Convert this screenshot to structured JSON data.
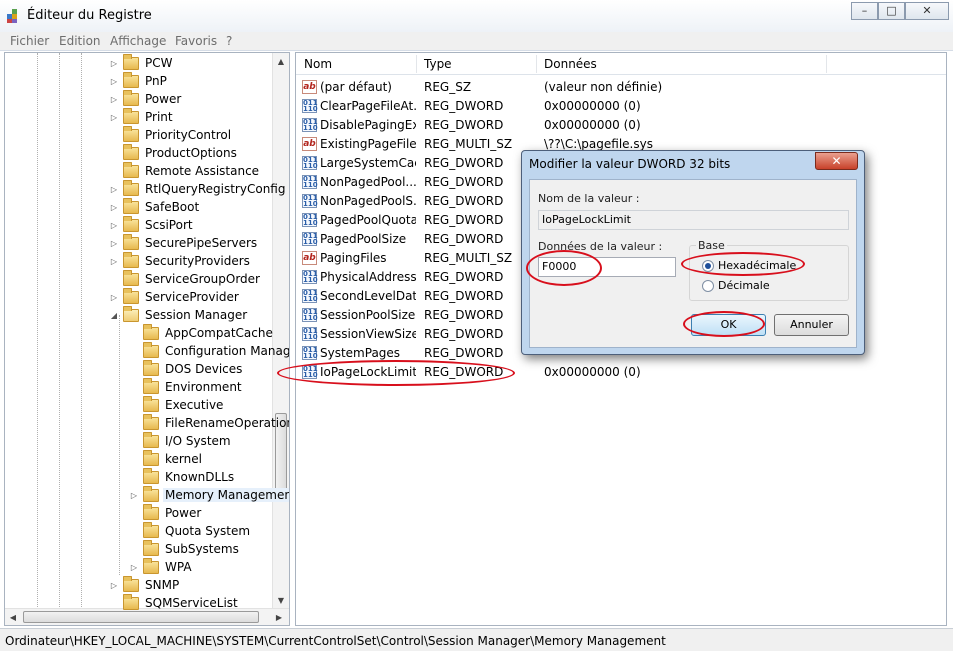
{
  "window": {
    "title": "Éditeur du Registre",
    "controls": {
      "minimize": "–",
      "maximize": "□",
      "close": "✕"
    }
  },
  "menu": [
    "Fichier",
    "Edition",
    "Affichage",
    "Favoris",
    "?"
  ],
  "tree": {
    "items": [
      {
        "label": "PCW",
        "level": 1,
        "arrow": "▷"
      },
      {
        "label": "PnP",
        "level": 1,
        "arrow": "▷"
      },
      {
        "label": "Power",
        "level": 1,
        "arrow": "▷"
      },
      {
        "label": "Print",
        "level": 1,
        "arrow": "▷"
      },
      {
        "label": "PriorityControl",
        "level": 1,
        "arrow": ""
      },
      {
        "label": "ProductOptions",
        "level": 1,
        "arrow": ""
      },
      {
        "label": "Remote Assistance",
        "level": 1,
        "arrow": ""
      },
      {
        "label": "RtlQueryRegistryConfig",
        "level": 1,
        "arrow": "▷"
      },
      {
        "label": "SafeBoot",
        "level": 1,
        "arrow": "▷"
      },
      {
        "label": "ScsiPort",
        "level": 1,
        "arrow": "▷"
      },
      {
        "label": "SecurePipeServers",
        "level": 1,
        "arrow": "▷"
      },
      {
        "label": "SecurityProviders",
        "level": 1,
        "arrow": "▷"
      },
      {
        "label": "ServiceGroupOrder",
        "level": 1,
        "arrow": ""
      },
      {
        "label": "ServiceProvider",
        "level": 1,
        "arrow": "▷"
      },
      {
        "label": "Session Manager",
        "level": 1,
        "arrow": "◢",
        "open": true
      },
      {
        "label": "AppCompatCache",
        "level": 2,
        "arrow": ""
      },
      {
        "label": "Configuration Manag",
        "level": 2,
        "arrow": ""
      },
      {
        "label": "DOS Devices",
        "level": 2,
        "arrow": ""
      },
      {
        "label": "Environment",
        "level": 2,
        "arrow": ""
      },
      {
        "label": "Executive",
        "level": 2,
        "arrow": ""
      },
      {
        "label": "FileRenameOperation",
        "level": 2,
        "arrow": ""
      },
      {
        "label": "I/O System",
        "level": 2,
        "arrow": ""
      },
      {
        "label": "kernel",
        "level": 2,
        "arrow": ""
      },
      {
        "label": "KnownDLLs",
        "level": 2,
        "arrow": ""
      },
      {
        "label": "Memory Managemen",
        "level": 2,
        "arrow": "▷",
        "selected": true
      },
      {
        "label": "Power",
        "level": 2,
        "arrow": ""
      },
      {
        "label": "Quota System",
        "level": 2,
        "arrow": ""
      },
      {
        "label": "SubSystems",
        "level": 2,
        "arrow": ""
      },
      {
        "label": "WPA",
        "level": 2,
        "arrow": "▷"
      },
      {
        "label": "SNMP",
        "level": 1,
        "arrow": "▷"
      },
      {
        "label": "SQMServiceList",
        "level": 1,
        "arrow": ""
      }
    ]
  },
  "list": {
    "columns": [
      "Nom",
      "Type",
      "Données"
    ],
    "rows": [
      {
        "icon": "ab",
        "name": "(par défaut)",
        "type": "REG_SZ",
        "data": "(valeur non définie)"
      },
      {
        "icon": "bin",
        "name": "ClearPageFileAt...",
        "type": "REG_DWORD",
        "data": "0x00000000 (0)"
      },
      {
        "icon": "bin",
        "name": "DisablePagingEx...",
        "type": "REG_DWORD",
        "data": "0x00000000 (0)"
      },
      {
        "icon": "ab",
        "name": "ExistingPageFiles",
        "type": "REG_MULTI_SZ",
        "data": "\\??\\C:\\pagefile.sys"
      },
      {
        "icon": "bin",
        "name": "LargeSystemCac...",
        "type": "REG_DWORD",
        "data": ""
      },
      {
        "icon": "bin",
        "name": "NonPagedPool...",
        "type": "REG_DWORD",
        "data": ""
      },
      {
        "icon": "bin",
        "name": "NonPagedPoolS...",
        "type": "REG_DWORD",
        "data": ""
      },
      {
        "icon": "bin",
        "name": "PagedPoolQuota",
        "type": "REG_DWORD",
        "data": ""
      },
      {
        "icon": "bin",
        "name": "PagedPoolSize",
        "type": "REG_DWORD",
        "data": ""
      },
      {
        "icon": "ab",
        "name": "PagingFiles",
        "type": "REG_MULTI_SZ",
        "data": ""
      },
      {
        "icon": "bin",
        "name": "PhysicalAddress...",
        "type": "REG_DWORD",
        "data": ""
      },
      {
        "icon": "bin",
        "name": "SecondLevelDat...",
        "type": "REG_DWORD",
        "data": ""
      },
      {
        "icon": "bin",
        "name": "SessionPoolSize",
        "type": "REG_DWORD",
        "data": ""
      },
      {
        "icon": "bin",
        "name": "SessionViewSize",
        "type": "REG_DWORD",
        "data": ""
      },
      {
        "icon": "bin",
        "name": "SystemPages",
        "type": "REG_DWORD",
        "data": ""
      },
      {
        "icon": "bin",
        "name": "IoPageLockLimit",
        "type": "REG_DWORD",
        "data": "0x00000000 (0)",
        "selected": true
      }
    ]
  },
  "dialog": {
    "title": "Modifier la valeur DWORD 32 bits",
    "close": "✕",
    "name_label": "Nom de la valeur :",
    "name_value": "IoPageLockLimit",
    "data_label": "Données de la valeur :",
    "data_value": "F0000",
    "base_label": "Base",
    "radio_hex": "Hexadécimale",
    "radio_dec": "Décimale",
    "ok": "OK",
    "cancel": "Annuler"
  },
  "status": "Ordinateur\\HKEY_LOCAL_MACHINE\\SYSTEM\\CurrentControlSet\\Control\\Session Manager\\Memory Management",
  "colors": {
    "annotation": "#d80f1c",
    "selection": "#e6f0fb"
  }
}
